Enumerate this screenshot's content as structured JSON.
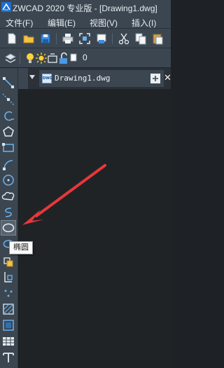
{
  "window": {
    "title": "ZWCAD 2020 专业版 - [Drawing1.dwg]"
  },
  "menubar": {
    "items": [
      "文件(F)",
      "编辑(E)",
      "视图(V)",
      "插入(I)"
    ]
  },
  "document": {
    "tab_name": "Drawing1.dwg",
    "close_glyph": "✕",
    "icon_text": "DWG"
  },
  "layer": {
    "value": "0"
  },
  "tooltip": {
    "text": "椭圆"
  },
  "colors": {
    "accent": "#e8373a",
    "panel": "#3b4651",
    "canvas": "#1f2326"
  }
}
